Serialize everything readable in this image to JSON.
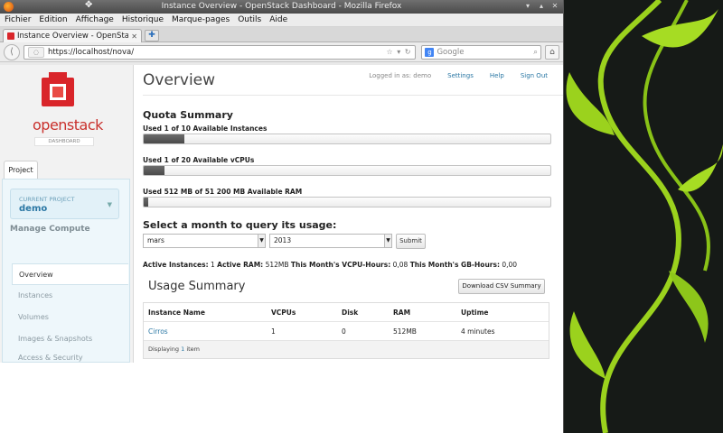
{
  "window": {
    "title": "Instance Overview - OpenStack Dashboard - Mozilla Firefox",
    "controls": [
      "▾",
      "▴",
      "✕"
    ]
  },
  "menu": [
    "Fichier",
    "Edition",
    "Affichage",
    "Historique",
    "Marque-pages",
    "Outils",
    "Aide"
  ],
  "tab": {
    "title": "Instance Overview - OpenStack...",
    "close": "✕",
    "new_tab": "✚"
  },
  "navbar": {
    "back": "⟨",
    "id_box": "◌",
    "url": "https://localhost/nova/",
    "url_controls": "☆ ▾ ↻",
    "search_engine": "g",
    "search_placeholder": "Google",
    "search_glyph": "⌕",
    "home": "⌂"
  },
  "sidebar": {
    "brand": "openstack",
    "brand_sub": "DASHBOARD",
    "tab_label": "Project",
    "current_project_caption": "CURRENT PROJECT",
    "current_project": "demo",
    "section_heading": "Manage Compute",
    "nav": [
      "Overview",
      "Instances",
      "Volumes",
      "Images & Snapshots",
      "Access & Security"
    ],
    "active_index": 0
  },
  "header": {
    "title": "Overview",
    "logged_in": "Logged in as: demo",
    "links": [
      "Settings",
      "Help",
      "Sign Out"
    ]
  },
  "quota": {
    "title": "Quota Summary",
    "items": [
      {
        "label": "Used 1 of 10 Available Instances",
        "fraction": 0.1
      },
      {
        "label": "Used 1 of 20 Available vCPUs",
        "fraction": 0.05
      },
      {
        "label": "Used 512 MB of 51 200 MB Available RAM",
        "fraction": 0.01
      }
    ]
  },
  "month_query": {
    "title": "Select a month to query its usage:",
    "month": "mars",
    "year": "2013",
    "submit": "Submit"
  },
  "usage_stats": {
    "active_instances_label": "Active Instances:",
    "active_instances": "1",
    "active_ram_label": "Active RAM:",
    "active_ram": "512MB",
    "vcpu_hours_label": "This Month's VCPU-Hours:",
    "vcpu_hours": "0,08",
    "gb_hours_label": "This Month's GB-Hours:",
    "gb_hours": "0,00"
  },
  "usage_summary": {
    "title": "Usage Summary",
    "csv_button": "Download CSV Summary",
    "columns": [
      "Instance Name",
      "VCPUs",
      "Disk",
      "RAM",
      "Uptime"
    ],
    "rows": [
      [
        "Cirros",
        "1",
        "0",
        "512MB",
        "4 minutes"
      ]
    ],
    "footer_prefix": "Displaying",
    "footer_count": "1",
    "footer_suffix": "item"
  }
}
